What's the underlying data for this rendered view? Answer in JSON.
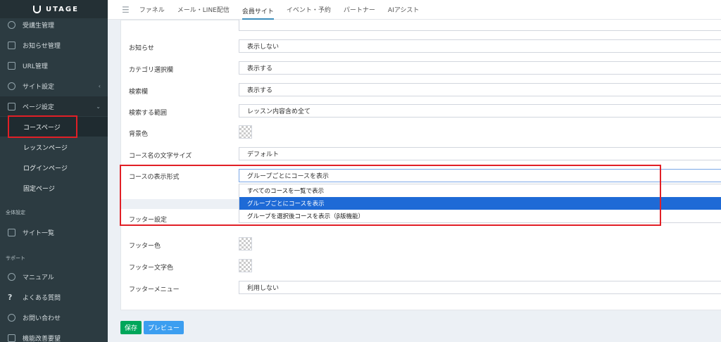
{
  "app": {
    "logo_text": "UTAGE"
  },
  "sidebar": {
    "items": [
      {
        "label": "受講生管理",
        "icon": "user-icon"
      },
      {
        "label": "お知らせ管理",
        "icon": "message-icon"
      },
      {
        "label": "URL管理",
        "icon": "link-icon"
      },
      {
        "label": "サイト設定",
        "icon": "gear-icon"
      },
      {
        "label": "ページ設定",
        "icon": "document-icon"
      }
    ],
    "sub_items": [
      "コースページ",
      "レッスンページ",
      "ログインページ",
      "固定ページ"
    ],
    "section_overall": "全体設定",
    "site_list": "サイト一覧",
    "section_support": "サポート",
    "support_items": [
      "マニュアル",
      "よくある質問",
      "お問い合わせ",
      "機能改善要望"
    ]
  },
  "topnav": {
    "items": [
      "ファネル",
      "メール・LINE配信",
      "会員サイト",
      "イベント・予約",
      "パートナー",
      "AIアシスト"
    ],
    "active": "会員サイト"
  },
  "form": {
    "rows": [
      {
        "label": "お知らせ",
        "value": "表示しない"
      },
      {
        "label": "カテゴリ選択欄",
        "value": "表示する"
      },
      {
        "label": "検索欄",
        "value": "表示する"
      },
      {
        "label": "検索する範囲",
        "value": "レッスン内容含め全て"
      },
      {
        "label": "背景色",
        "value": ""
      },
      {
        "label": "コース名の文字サイズ",
        "value": "デフォルト"
      }
    ],
    "display_format": {
      "label": "コースの表示形式",
      "value": "グループごとにコースを表示",
      "options": [
        "すべてのコースを一覧で表示",
        "グループごとにコースを表示",
        "グループを選択後コースを表示（β版機能）"
      ],
      "selected_index": 1
    },
    "footer_section": "フッター設定",
    "footer_rows": [
      {
        "label": "フッター色",
        "value": ""
      },
      {
        "label": "フッター文字色",
        "value": ""
      },
      {
        "label": "フッターメニュー",
        "value": "利用しない"
      }
    ]
  },
  "buttons": {
    "save": "保存",
    "preview": "プレビュー"
  },
  "colors": {
    "sidebar": "#2c3b41",
    "highlight": "#e11f26",
    "save": "#00a65a",
    "preview": "#3c9ef0",
    "selected_option": "#1e6ad6"
  }
}
